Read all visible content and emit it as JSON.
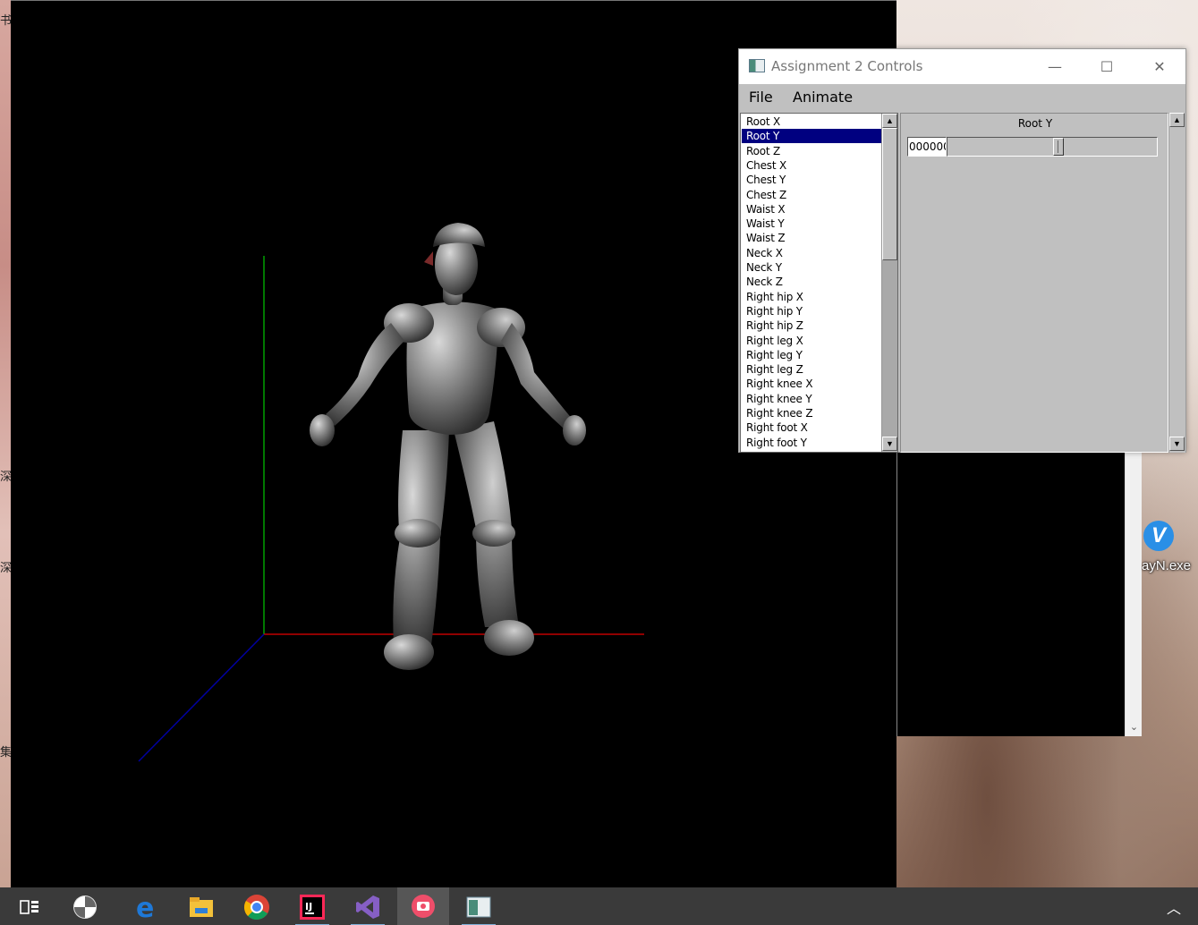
{
  "desktop": {
    "left_chars": [
      "书",
      "深",
      "深",
      "集"
    ],
    "icon_label": "ayN.exe",
    "icon_glyph": "V"
  },
  "viewport": {
    "axis_colors": {
      "x": "#c00000",
      "y": "#00a000",
      "z": "#0000a0"
    }
  },
  "window": {
    "title": "Assignment 2 Controls",
    "minimize": "—",
    "maximize": "☐",
    "close": "✕",
    "menu": [
      "File",
      "Animate"
    ]
  },
  "joint_list": {
    "selected_index": 1,
    "items": [
      "Root X",
      "Root Y",
      "Root Z",
      "Chest X",
      "Chest Y",
      "Chest Z",
      "Waist X",
      "Waist Y",
      "Waist Z",
      "Neck X",
      "Neck Y",
      "Neck Z",
      "Right hip X",
      "Right hip Y",
      "Right hip Z",
      "Right leg X",
      "Right leg Y",
      "Right leg Z",
      "Right knee X",
      "Right knee Y",
      "Right knee Z",
      "Right foot X",
      "Right foot Y"
    ]
  },
  "slider": {
    "label": "Root Y",
    "value_text": "000000",
    "level_fraction": 0.53
  },
  "taskbar": {
    "icons": [
      "task-view",
      "pinwheel-app",
      "edge",
      "file-explorer",
      "chrome",
      "intellij",
      "visual-studio",
      "screen-recorder",
      "assignment-app"
    ]
  }
}
